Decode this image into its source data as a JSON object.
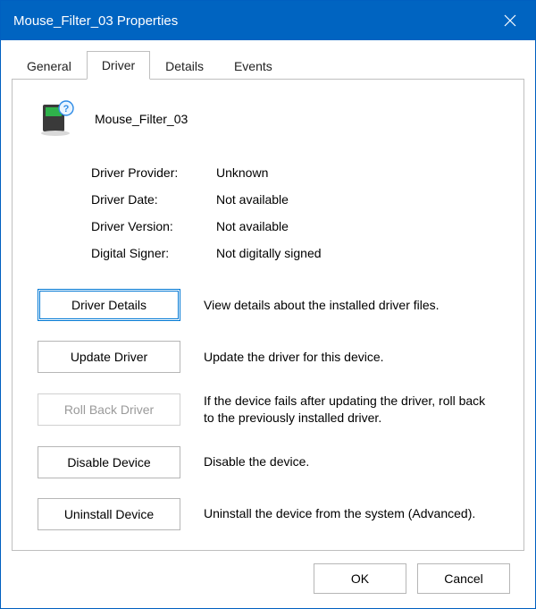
{
  "title": "Mouse_Filter_03 Properties",
  "tabs": {
    "general": "General",
    "driver": "Driver",
    "details": "Details",
    "events": "Events"
  },
  "device_name": "Mouse_Filter_03",
  "info": {
    "provider_label": "Driver Provider:",
    "provider_value": "Unknown",
    "date_label": "Driver Date:",
    "date_value": "Not available",
    "version_label": "Driver Version:",
    "version_value": "Not available",
    "signer_label": "Digital Signer:",
    "signer_value": "Not digitally signed"
  },
  "actions": {
    "details": {
      "label": "Driver Details",
      "desc": "View details about the installed driver files."
    },
    "update": {
      "label": "Update Driver",
      "desc": "Update the driver for this device."
    },
    "rollback": {
      "label": "Roll Back Driver",
      "desc": "If the device fails after updating the driver, roll back to the previously installed driver."
    },
    "disable": {
      "label": "Disable Device",
      "desc": "Disable the device."
    },
    "uninstall": {
      "label": "Uninstall Device",
      "desc": "Uninstall the device from the system (Advanced)."
    }
  },
  "footer": {
    "ok": "OK",
    "cancel": "Cancel"
  }
}
